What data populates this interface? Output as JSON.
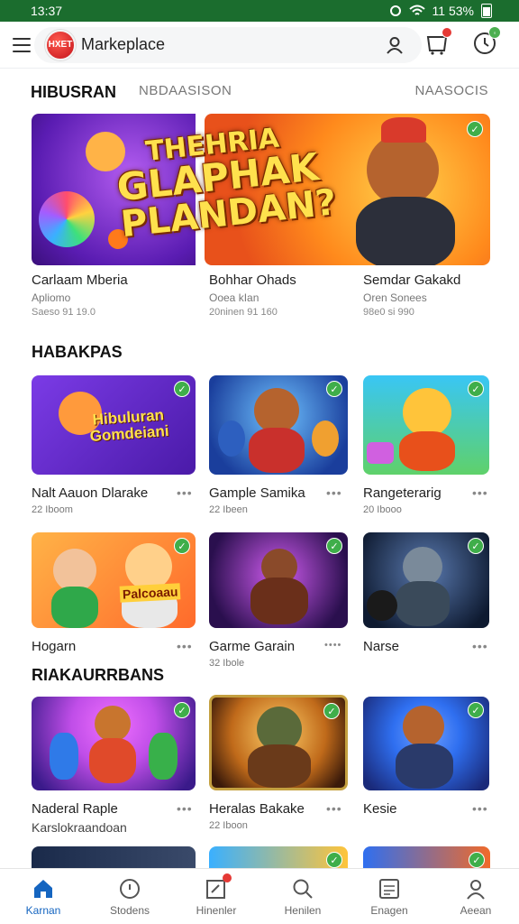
{
  "status_bar": {
    "time": "13:37",
    "battery": "11 53%"
  },
  "app_bar": {
    "logo_text": "HXET",
    "title": "Markeplace"
  },
  "tabs": [
    "HIBUSRAN",
    "NBDAASISON",
    "NAASOCIS"
  ],
  "hero": {
    "headline": [
      "THEHRIA",
      "GLAPHAK",
      "PLANDAN?"
    ],
    "items": [
      {
        "title": "Carlaam Mberia",
        "subtitle": "Apliomo",
        "meta": "Saeso 91 19.0"
      },
      {
        "title": "Bohhar Ohads",
        "subtitle": "Ooea kIan",
        "meta": "20ninen 91 160"
      },
      {
        "title": "Semdar Gakakd",
        "subtitle": "Oren Sonees",
        "meta": "98e0 si 990"
      }
    ]
  },
  "sections": [
    {
      "title": "HABAKPAS",
      "rows": [
        [
          {
            "title": "Nalt Aauon Dlarake",
            "subtitle": "22 Iboom",
            "art_text": "Hibuluran Gomdeiani",
            "colors": [
              "#7b3be6",
              "#4a1aa8"
            ]
          },
          {
            "title": "Gample Samika",
            "subtitle": "22 Ibeen",
            "art_text": "",
            "colors": [
              "#3b8fe8",
              "#1a3e9c"
            ]
          },
          {
            "title": "Rangeterarig",
            "subtitle": "20 Ibooo",
            "art_text": "",
            "colors": [
              "#39c6f5",
              "#5fd16a"
            ]
          }
        ],
        [
          {
            "title": "Hogarn",
            "subtitle": "",
            "art_text": "Palcoaau",
            "colors": [
              "#ffb347",
              "#ff6a2b"
            ]
          },
          {
            "title": "Garme Garain",
            "subtitle": "32 Ibole",
            "art_text": "",
            "colors": [
              "#b03bd6",
              "#2a0f4e"
            ]
          },
          {
            "title": "Narse",
            "subtitle": "",
            "art_text": "",
            "colors": [
              "#3a5a8a",
              "#0e1a30"
            ]
          }
        ]
      ]
    },
    {
      "title": "RIAKAURRBANS",
      "rows": [
        [
          {
            "title": "Naderal Raple",
            "subtitle": "Karslokraandoan",
            "art_text": "",
            "colors": [
              "#c04ee8",
              "#3a1a8a"
            ]
          },
          {
            "title": "Heralas Bakake",
            "subtitle": "22 Iboon",
            "art_text": "",
            "colors": [
              "#f0a030",
              "#5a2a0a"
            ]
          },
          {
            "title": "Kesie",
            "subtitle": "",
            "art_text": "",
            "colors": [
              "#2f6ff0",
              "#1a2a7a"
            ]
          }
        ]
      ]
    }
  ],
  "more_dots": "•••",
  "more_dots_alt": "••••",
  "bottom_nav": [
    {
      "label": "Karnan",
      "icon": "home-icon",
      "active": true
    },
    {
      "label": "Stodens",
      "icon": "compass-icon",
      "active": false
    },
    {
      "label": "Hinenler",
      "icon": "edit-icon",
      "active": false
    },
    {
      "label": "Henilen",
      "icon": "search-icon",
      "active": false
    },
    {
      "label": "Enagen",
      "icon": "list-icon",
      "active": false
    },
    {
      "label": "Aeean",
      "icon": "profile-icon",
      "active": false
    }
  ],
  "accent_color": "#1565c0",
  "verified_color": "#3fae4a"
}
